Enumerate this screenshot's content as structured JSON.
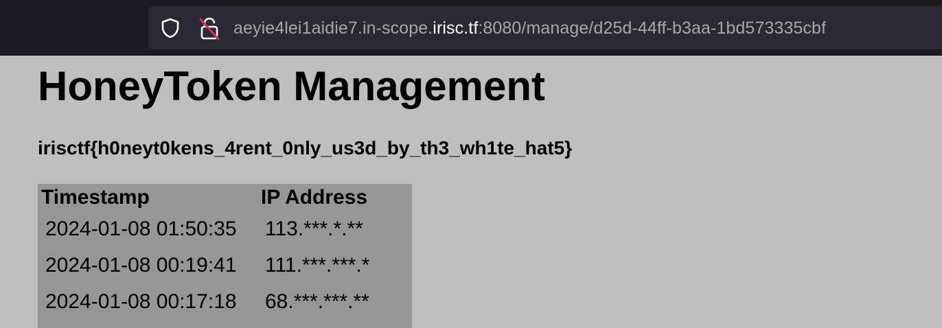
{
  "browser": {
    "url_prefix": "aeyie4lei1aidie7.in-scope.",
    "url_host": "irisc.tf",
    "url_suffix": ":8080/manage/d25d-44ff-b3aa-1bd573335cbf",
    "icons": [
      "shield-icon",
      "insecure-lock-icon"
    ]
  },
  "page": {
    "title": "HoneyToken Management",
    "flag": "irisctf{h0neyt0kens_4rent_0nly_us3d_by_th3_wh1te_hat5}"
  },
  "table": {
    "headers": [
      "Timestamp",
      "IP Address"
    ],
    "rows": [
      [
        "2024-01-08 01:50:35",
        "113.***.*.**"
      ],
      [
        "2024-01-08 00:19:41",
        "111.***.***.*"
      ],
      [
        "2024-01-08 00:17:18",
        "68.***.***.**"
      ]
    ]
  }
}
